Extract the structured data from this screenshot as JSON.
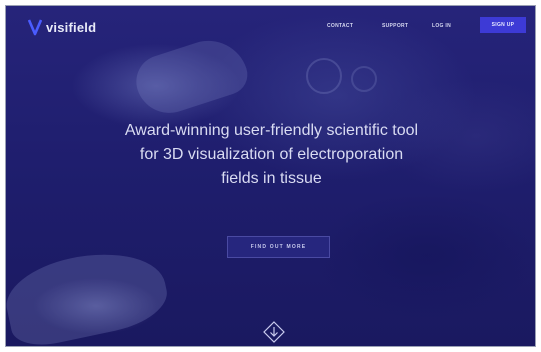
{
  "brand": {
    "name": "visifield",
    "icon": "v-logo-icon"
  },
  "nav": {
    "contact": "CONTACT",
    "support": "SUPPORT",
    "login": "LOG IN",
    "signup": "SIGN UP"
  },
  "hero": {
    "line1": "Award-winning user-friendly scientific tool",
    "line2": "for 3D visualization of electroporation",
    "line3": "fields in tissue"
  },
  "cta": {
    "label": "FIND OUT MORE"
  },
  "scroll": {
    "icon": "arrow-down-diamond-icon"
  },
  "colors": {
    "background": "#22216f",
    "accent": "#3d3ad6",
    "text": "#d9dbf2"
  }
}
